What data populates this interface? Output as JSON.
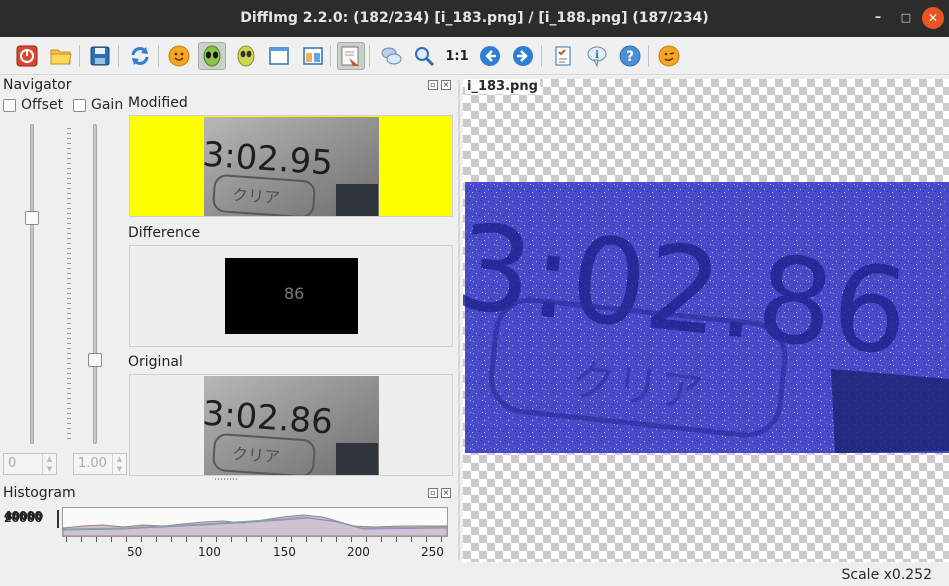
{
  "window": {
    "title": "DiffImg 2.2.0:  (182/234) [i_183.png] / [i_188.png] (187/234)",
    "minimize": "–",
    "maximize": "□",
    "close": "✕"
  },
  "toolbar": {
    "icons": [
      "power-icon",
      "open-folder-icon",
      "save-icon",
      "refresh-icon",
      "smiley-icon",
      "alien-active-icon",
      "alien-icon",
      "single-view-icon",
      "dual-view-icon",
      "highlight-icon",
      "chat-icon",
      "zoom-fit-icon",
      "zoom-one-icon",
      "previous-icon",
      "next-icon",
      "checklist-icon",
      "info-icon",
      "help-icon",
      "about-icon"
    ],
    "zoom_one_label": "1:1"
  },
  "navigator": {
    "title": "Navigator",
    "offset_label": "Offset",
    "gain_label": "Gain",
    "offset_value": "0",
    "gain_value": "1.00",
    "offset_checked": false,
    "gain_checked": false
  },
  "views": {
    "modified_label": "Modified",
    "difference_label": "Difference",
    "original_label": "Original",
    "modified_text": "3:02.95",
    "original_text": "3:02.86",
    "thumb_button_text": "クリア",
    "difference_text": "86"
  },
  "histogram": {
    "title": "Histogram",
    "y_labels": [
      "40000",
      "80000",
      "20000"
    ],
    "y_label_display": "4⁰0000",
    "x_ticks": [
      "50",
      "100",
      "150",
      "200",
      "250"
    ]
  },
  "image_view": {
    "filename": "i_183.png",
    "display_text": "3:02.86",
    "button_text": "クリア"
  },
  "status": {
    "scale": "Scale x0.252"
  },
  "colors": {
    "title_bg": "#2c2c2c",
    "close_button": "#e95420",
    "modified_pad": "#ffff00",
    "overlay_blue": "#4a4acb"
  }
}
